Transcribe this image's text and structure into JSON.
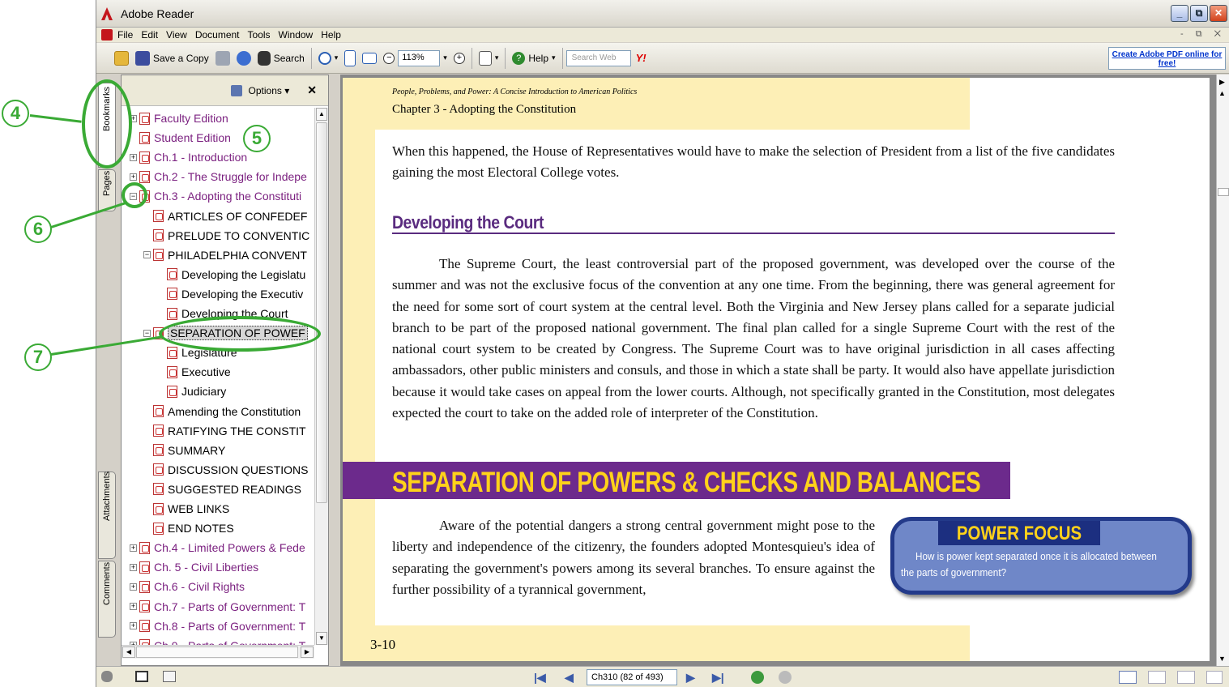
{
  "window": {
    "title": "Adobe Reader",
    "controls": [
      "_",
      "⧉",
      "✕"
    ]
  },
  "menu": {
    "items": [
      "File",
      "Edit",
      "View",
      "Document",
      "Tools",
      "Window",
      "Help"
    ],
    "mdi_controls": "- ⧉ ✕"
  },
  "toolbar": {
    "save_copy": "Save a Copy",
    "search": "Search",
    "zoom": "113%",
    "help": "Help",
    "search_web_placeholder": "Search Web",
    "yahoo": "Y!",
    "create_pdf_line1": "Create Adobe PDF online for",
    "create_pdf_line2": "free!"
  },
  "side_tabs": {
    "bookmarks": "Bookmarks",
    "pages": "Pages",
    "attachments": "Attachments",
    "comments": "Comments"
  },
  "bookmarks_panel": {
    "options": "Options",
    "close": "✕",
    "items": [
      {
        "label": "Faculty Edition",
        "level": 0,
        "expander": "+",
        "color": "purple"
      },
      {
        "label": "Student Edition",
        "level": 0,
        "expander": "",
        "color": "purple"
      },
      {
        "label": "Ch.1 - Introduction",
        "level": 0,
        "expander": "+",
        "color": "purple"
      },
      {
        "label": "Ch.2 - The Struggle for Indepe",
        "level": 0,
        "expander": "+",
        "color": "purple"
      },
      {
        "label": "Ch.3 - Adopting the Constituti",
        "level": 0,
        "expander": "−",
        "color": "purple"
      },
      {
        "label": "ARTICLES OF CONFEDEF",
        "level": 1,
        "expander": "",
        "color": "black"
      },
      {
        "label": "PRELUDE TO CONVENTIC",
        "level": 1,
        "expander": "",
        "color": "black"
      },
      {
        "label": "PHILADELPHIA CONVENT",
        "level": 1,
        "expander": "−",
        "color": "black"
      },
      {
        "label": "Developing the Legislatu",
        "level": 2,
        "expander": "",
        "color": "black"
      },
      {
        "label": "Developing the Executiv",
        "level": 2,
        "expander": "",
        "color": "black"
      },
      {
        "label": "Developing the Court",
        "level": 2,
        "expander": "",
        "color": "black"
      },
      {
        "label": "SEPARATION OF POWEF",
        "level": 1,
        "expander": "−",
        "color": "black",
        "selected": true
      },
      {
        "label": "Legislature",
        "level": 2,
        "expander": "",
        "color": "black"
      },
      {
        "label": "Executive",
        "level": 2,
        "expander": "",
        "color": "black"
      },
      {
        "label": "Judiciary",
        "level": 2,
        "expander": "",
        "color": "black"
      },
      {
        "label": "Amending the Constitution",
        "level": 1,
        "expander": "",
        "color": "black"
      },
      {
        "label": "RATIFYING THE CONSTIT",
        "level": 1,
        "expander": "",
        "color": "black"
      },
      {
        "label": "SUMMARY",
        "level": 1,
        "expander": "",
        "color": "black"
      },
      {
        "label": "DISCUSSION QUESTIONS",
        "level": 1,
        "expander": "",
        "color": "black"
      },
      {
        "label": "SUGGESTED READINGS",
        "level": 1,
        "expander": "",
        "color": "black"
      },
      {
        "label": "WEB LINKS",
        "level": 1,
        "expander": "",
        "color": "black"
      },
      {
        "label": "END NOTES",
        "level": 1,
        "expander": "",
        "color": "black"
      },
      {
        "label": "Ch.4 - Limited Powers & Fede",
        "level": 0,
        "expander": "+",
        "color": "purple"
      },
      {
        "label": "Ch. 5 - Civil Liberties",
        "level": 0,
        "expander": "+",
        "color": "purple"
      },
      {
        "label": "Ch.6 - Civil Rights",
        "level": 0,
        "expander": "+",
        "color": "purple"
      },
      {
        "label": "Ch.7 - Parts of Government: T",
        "level": 0,
        "expander": "+",
        "color": "purple"
      },
      {
        "label": "Ch.8 - Parts of Government: T",
        "level": 0,
        "expander": "+",
        "color": "purple"
      },
      {
        "label": "Ch.9 - Parts of Government: T",
        "level": 0,
        "expander": "+",
        "color": "purple"
      }
    ]
  },
  "document": {
    "running_head": "People, Problems, and Power: A Concise Introduction to American Politics",
    "chapter": "Chapter 3 - Adopting the Constitution",
    "para1": "When this happened, the House of Representatives would have to make the selection of President from a list of the five candidates gaining the most Electoral College votes.",
    "heading_court": "Developing the Court",
    "para_court": "The Supreme Court, the least controversial part of the proposed government, was developed over the course of the summer and was not the exclusive focus of the convention at any one time. From the beginning, there was general agreement for the need for some sort of court system at the central level. Both the Virginia and New Jersey plans called for a separate judicial branch to be part of the proposed national government. The final plan called for a single Supreme Court with the rest of the national court system to be created by Congress. The Supreme Court was to have original jurisdiction in all cases affecting ambassadors, other public ministers and consuls, and those in which a state shall be party. It would also have appellate jurisdiction because it would take cases on appeal from the lower courts. Although, not specifically granted in the Constitution, most delegates expected the court to take on the added role of interpreter of the Constitution.",
    "banner": "SEPARATION OF POWERS & CHECKS AND BALANCES",
    "para_sep": "Aware of the potential dangers a strong central government might pose to the liberty and independence of the citizenry, the founders adopted Montesquieu's idea of separating the government's powers among its several branches. To ensure against the further possibility of a tyrannical government,",
    "power_focus_title": "POWER FOCUS",
    "power_focus_text": "How is power kept separated once it is allocated between the parts of government?",
    "page_number": "3-10"
  },
  "status": {
    "page_indicator": "Ch310  (82 of 493)"
  },
  "annotations": [
    "4",
    "5",
    "6",
    "7"
  ],
  "colors": {
    "accent_purple": "#6c2a8c",
    "banner_yellow": "#ffd21a",
    "annotation_green": "#3aaa35",
    "page_band": "#fdefb6"
  }
}
